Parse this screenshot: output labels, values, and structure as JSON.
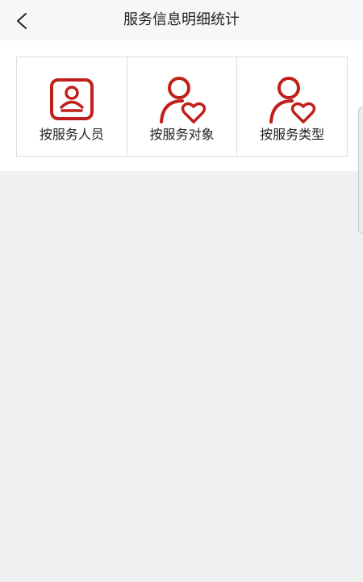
{
  "header": {
    "title": "服务信息明细统计",
    "back_icon": "chevron-left-icon"
  },
  "categories": [
    {
      "label": "按服务人员",
      "icon": "staff-id-card-icon"
    },
    {
      "label": "按服务对象",
      "icon": "person-heart-icon"
    },
    {
      "label": "按服务类型",
      "icon": "person-heart-icon"
    }
  ],
  "colors": {
    "accent": "#c0201c",
    "background": "#f0f0f0",
    "header_bg": "#f7f7f7"
  }
}
